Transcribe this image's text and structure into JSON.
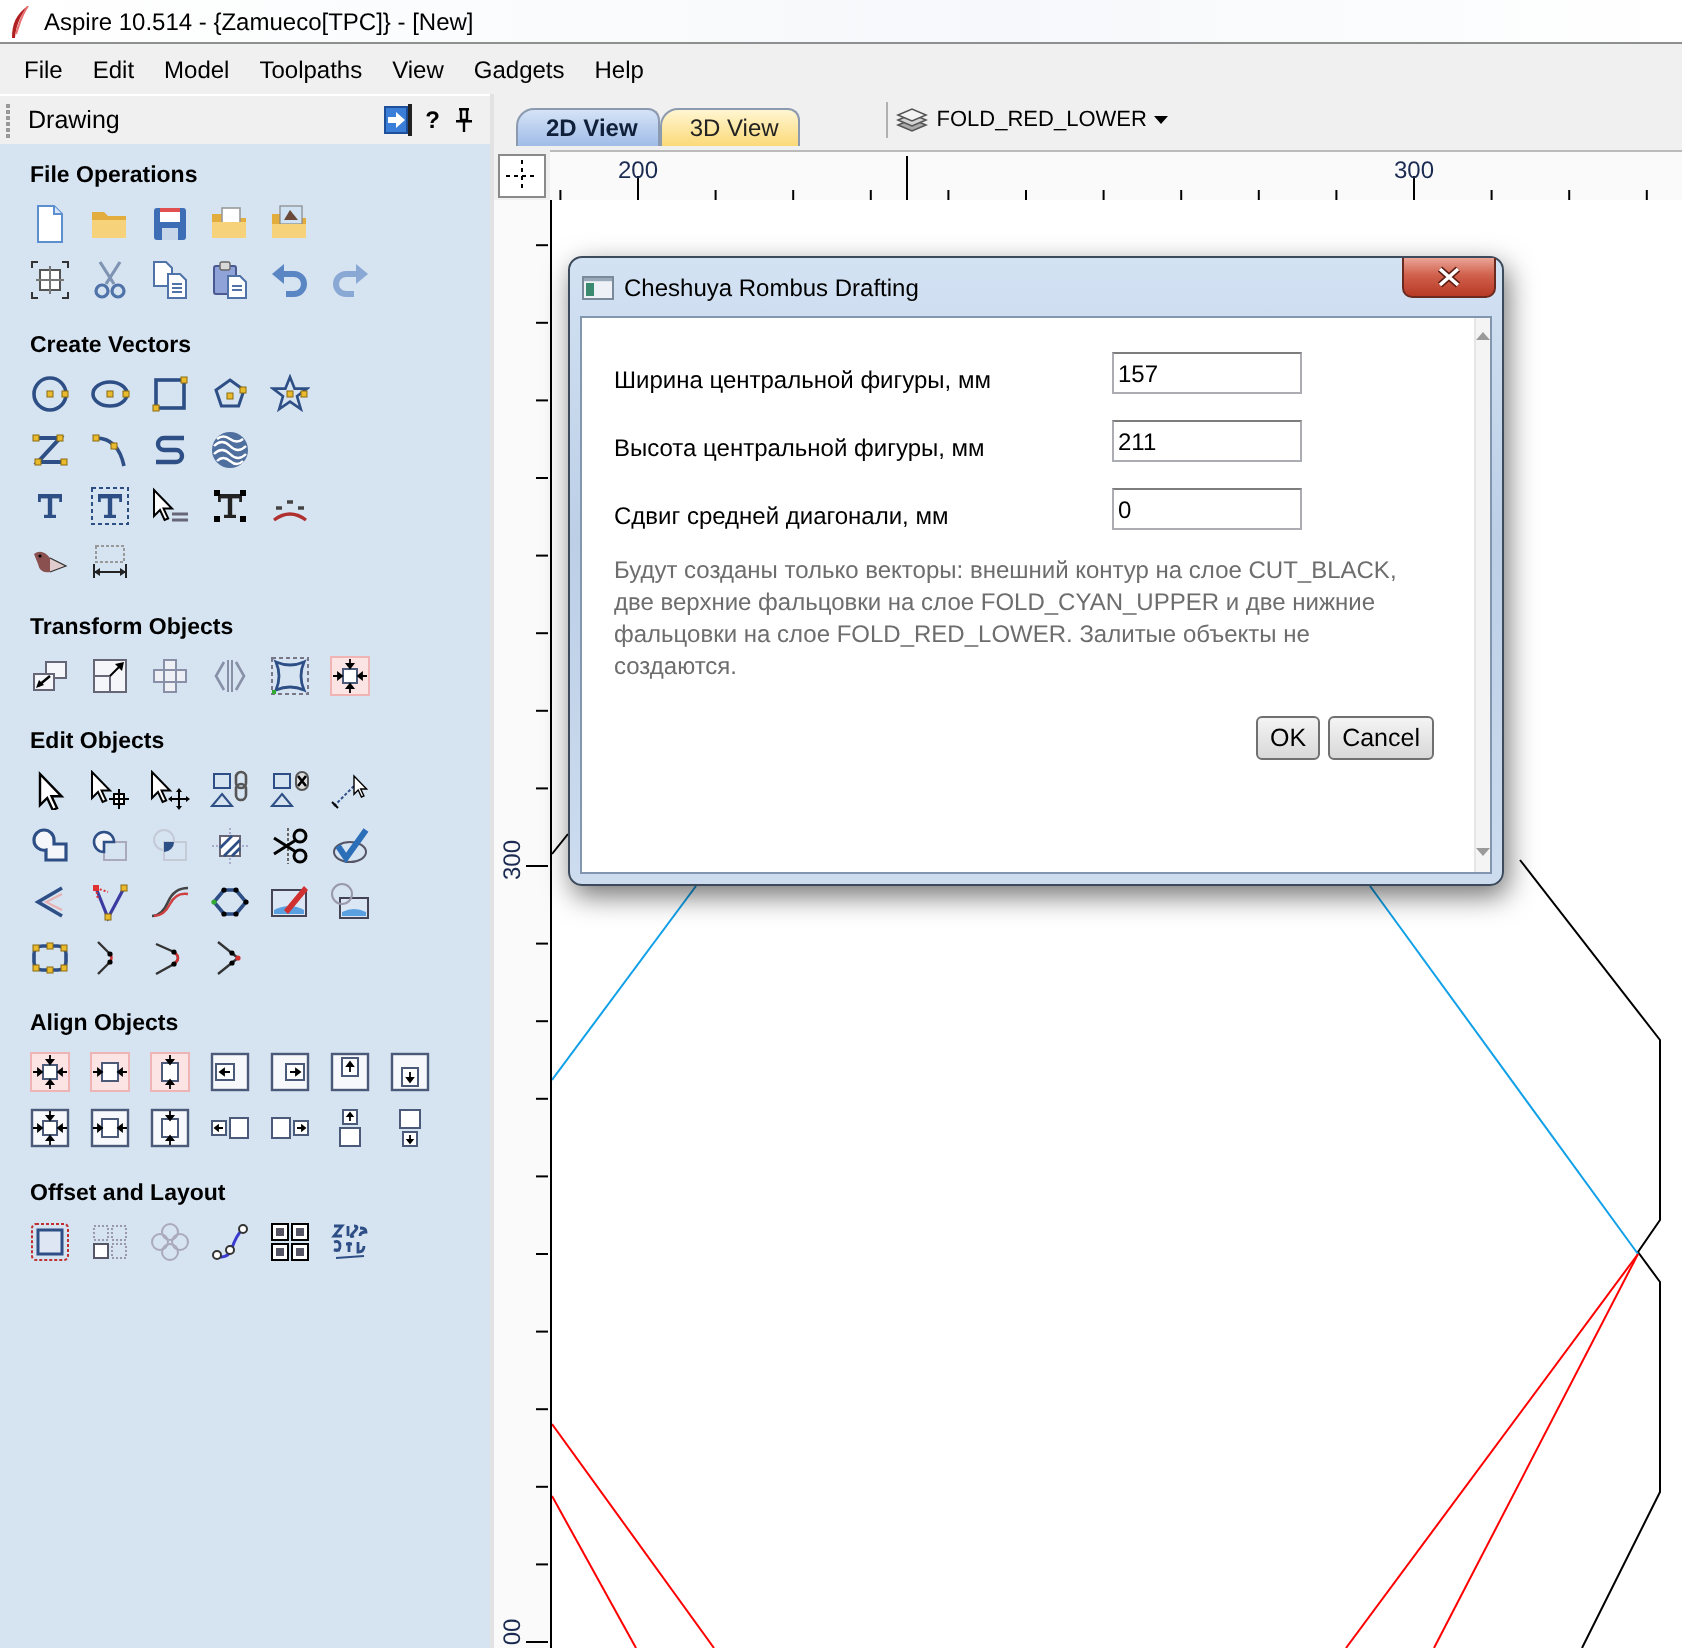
{
  "window": {
    "title": "Aspire 10.514 - {Zamueco[TPC]} - [New]"
  },
  "menu": [
    "File",
    "Edit",
    "Model",
    "Toolpaths",
    "View",
    "Gadgets",
    "Help"
  ],
  "drawing_panel": {
    "title": "Drawing",
    "help": "?",
    "sections": [
      {
        "title": "File Operations"
      },
      {
        "title": "Create Vectors"
      },
      {
        "title": "Transform Objects"
      },
      {
        "title": "Edit Objects"
      },
      {
        "title": "Align Objects"
      },
      {
        "title": "Offset and Layout"
      }
    ]
  },
  "view_tabs": [
    {
      "label": "2D View",
      "selected": true
    },
    {
      "label": "3D View",
      "selected": false
    }
  ],
  "layer_dropdown": {
    "value": "FOLD_RED_LOWER"
  },
  "rulers": {
    "top": [
      {
        "label": "200"
      },
      {
        "label": "300"
      }
    ],
    "left": [
      {
        "label": "300"
      },
      {
        "label": "00"
      }
    ]
  },
  "dialog": {
    "title": "Cheshuya Rombus Drafting",
    "fields": [
      {
        "label": "Ширина центральной фигуры, мм",
        "value": "157"
      },
      {
        "label": "Высота центральной фигуры, мм",
        "value": "211"
      },
      {
        "label": "Сдвиг средней диагонали, мм",
        "value": "0"
      }
    ],
    "note": "Будут созданы только векторы: внешний контур на слое CUT_BLACK, две верхние фальцовки на слое FOLD_CYAN_UPPER и две нижние фальцовки на слое FOLD_RED_LOWER. Залитые объекты не создаются.",
    "buttons": [
      "OK",
      "Cancel"
    ]
  }
}
